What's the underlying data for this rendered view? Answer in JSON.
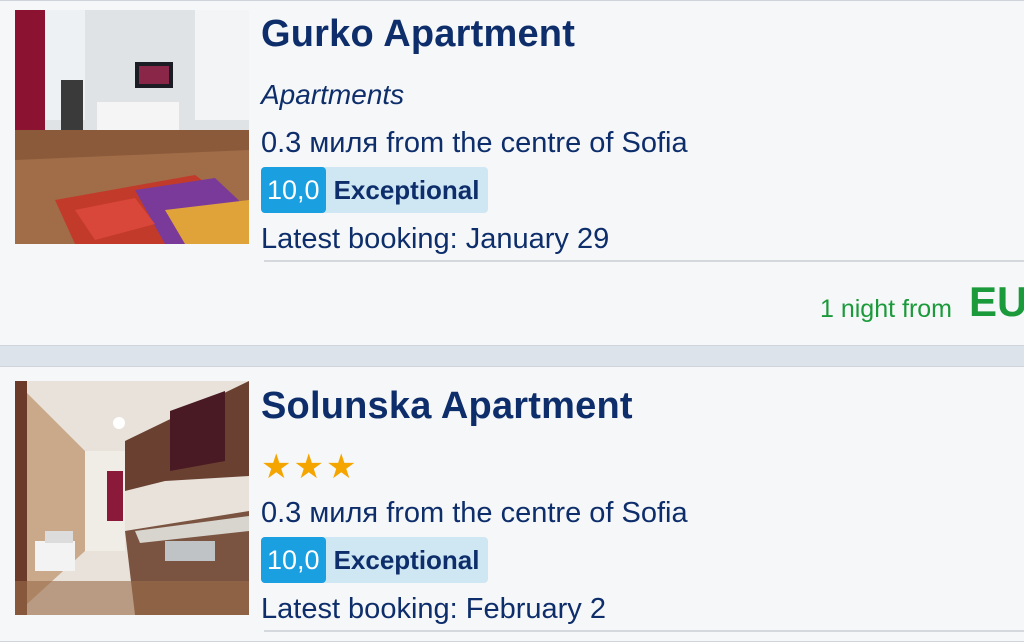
{
  "listings": [
    {
      "name": "Gurko Apartment",
      "type": "Apartments",
      "distance": "0.3 миля from the centre of Sofia",
      "score": "10,0",
      "score_word": "Exceptional",
      "latest_booking": "Latest booking: January 29",
      "price_label": "1 night from",
      "price_value": "EU"
    },
    {
      "name": "Solunska Apartment",
      "stars": "★★★",
      "star_rating": 3,
      "distance": "0.3 миля from the centre of Sofia",
      "score": "10,0",
      "score_word": "Exceptional",
      "latest_booking": "Latest booking: February 2"
    }
  ],
  "colors": {
    "title": "#0d2e6b",
    "score_badge": "#1a9fe0",
    "score_bg": "#cfe7f3",
    "price": "#1b9a3b",
    "stars": "#f5a500"
  }
}
